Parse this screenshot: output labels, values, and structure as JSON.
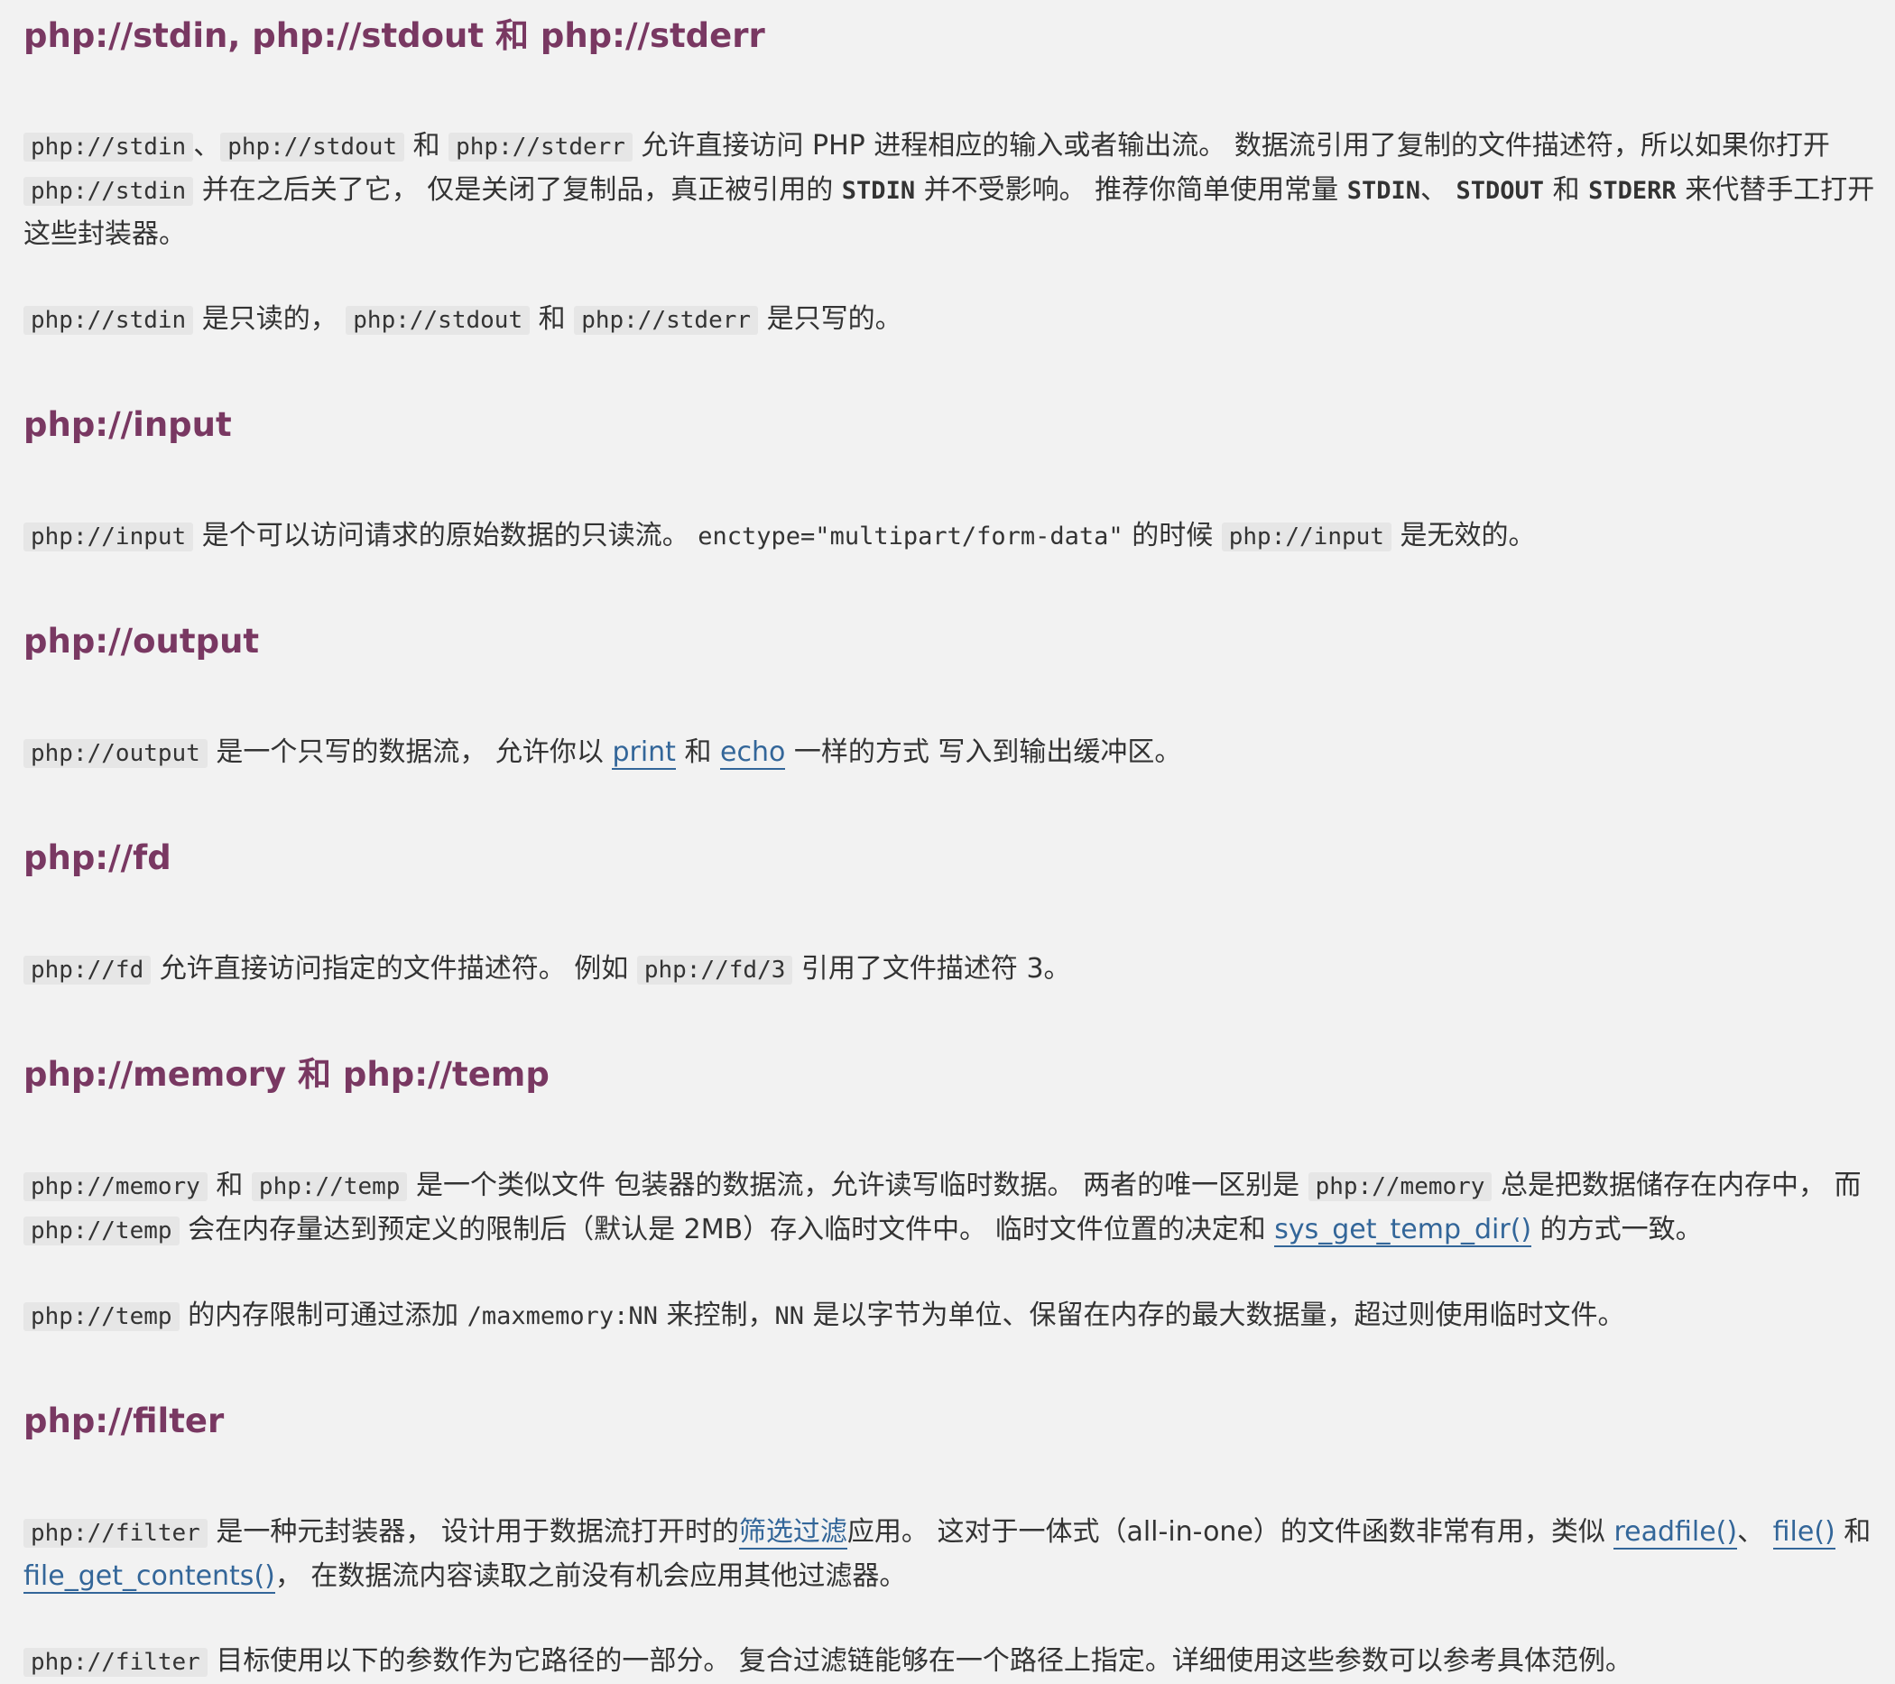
{
  "sec_stdio": {
    "title": "php://stdin, php://stdout 和 php://stderr",
    "p1": {
      "c1": "php://stdin",
      "t1": "、",
      "c2": "php://stdout",
      "t2": " 和 ",
      "c3": "php://stderr",
      "t3": " 允许直接访问 PHP 进程相应的输入或者输出流。 数据流引用了复制的文件描述符，所以如果你打开 ",
      "c4": "php://stdin",
      "t4": " 并在之后关了它， 仅是关闭了复制品，真正被引用的 ",
      "k1": "STDIN",
      "t5": " 并不受影响。 推荐你简单使用常量 ",
      "k2": "STDIN",
      "t6": "、 ",
      "k3": "STDOUT",
      "t7": " 和 ",
      "k4": "STDERR",
      "t8": " 来代替手工打开这些封装器。"
    },
    "p2": {
      "c1": "php://stdin",
      "t1": " 是只读的， ",
      "c2": "php://stdout",
      "t2": " 和 ",
      "c3": "php://stderr",
      "t3": " 是只写的。"
    }
  },
  "sec_input": {
    "title": "php://input",
    "p1": {
      "c1": "php://input",
      "t1": " 是个可以访问请求的原始数据的只读流。 ",
      "m1": "enctype=\"multipart/form-data\"",
      "t2": " 的时候 ",
      "c2": "php://input",
      "t3": " 是无效的。"
    }
  },
  "sec_output": {
    "title": "php://output",
    "p1": {
      "c1": "php://output",
      "t1": " 是一个只写的数据流， 允许你以 ",
      "l1": "print",
      "t2": " 和 ",
      "l2": "echo",
      "t3": " 一样的方式 写入到输出缓冲区。"
    }
  },
  "sec_fd": {
    "title": "php://fd",
    "p1": {
      "c1": "php://fd",
      "t1": " 允许直接访问指定的文件描述符。 例如 ",
      "c2": "php://fd/3",
      "t2": " 引用了文件描述符 3。"
    }
  },
  "sec_memory": {
    "title": "php://memory 和 php://temp",
    "p1": {
      "c1": "php://memory",
      "t1": " 和 ",
      "c2": "php://temp",
      "t2": " 是一个类似文件 包装器的数据流，允许读写临时数据。 两者的唯一区别是 ",
      "c3": "php://memory",
      "t3": " 总是把数据储存在内存中， 而 ",
      "c4": "php://temp",
      "t4": " 会在内存量达到预定义的限制后（默认是 2MB）存入临时文件中。 临时文件位置的决定和 ",
      "l1": "sys_get_temp_dir()",
      "t5": " 的方式一致。"
    },
    "p2": {
      "c1": "php://temp",
      "t1": " 的内存限制可通过添加 ",
      "m1": "/maxmemory:NN",
      "t2": " 来控制，",
      "m2": "NN",
      "t3": " 是以字节为单位、保留在内存的最大数据量，超过则使用临时文件。"
    }
  },
  "sec_filter": {
    "title": "php://filter",
    "p1": {
      "c1": "php://filter",
      "t1": " 是一种元封装器， 设计用于数据流打开时的",
      "l1": "筛选过滤",
      "t2": "应用。 这对于一体式（all-in-one）的文件函数非常有用，类似 ",
      "l2": "readfile()",
      "t3": "、 ",
      "l3": "file()",
      "t4": " 和 ",
      "l4": "file_get_contents()",
      "t5": "， 在数据流内容读取之前没有机会应用其他过滤器。"
    },
    "p2": {
      "c1": "php://filter",
      "t1": " 目标使用以下的参数作为它路径的一部分。 复合过滤链能够在一个路径上指定。详细使用这些参数可以参考具体范例。"
    }
  }
}
